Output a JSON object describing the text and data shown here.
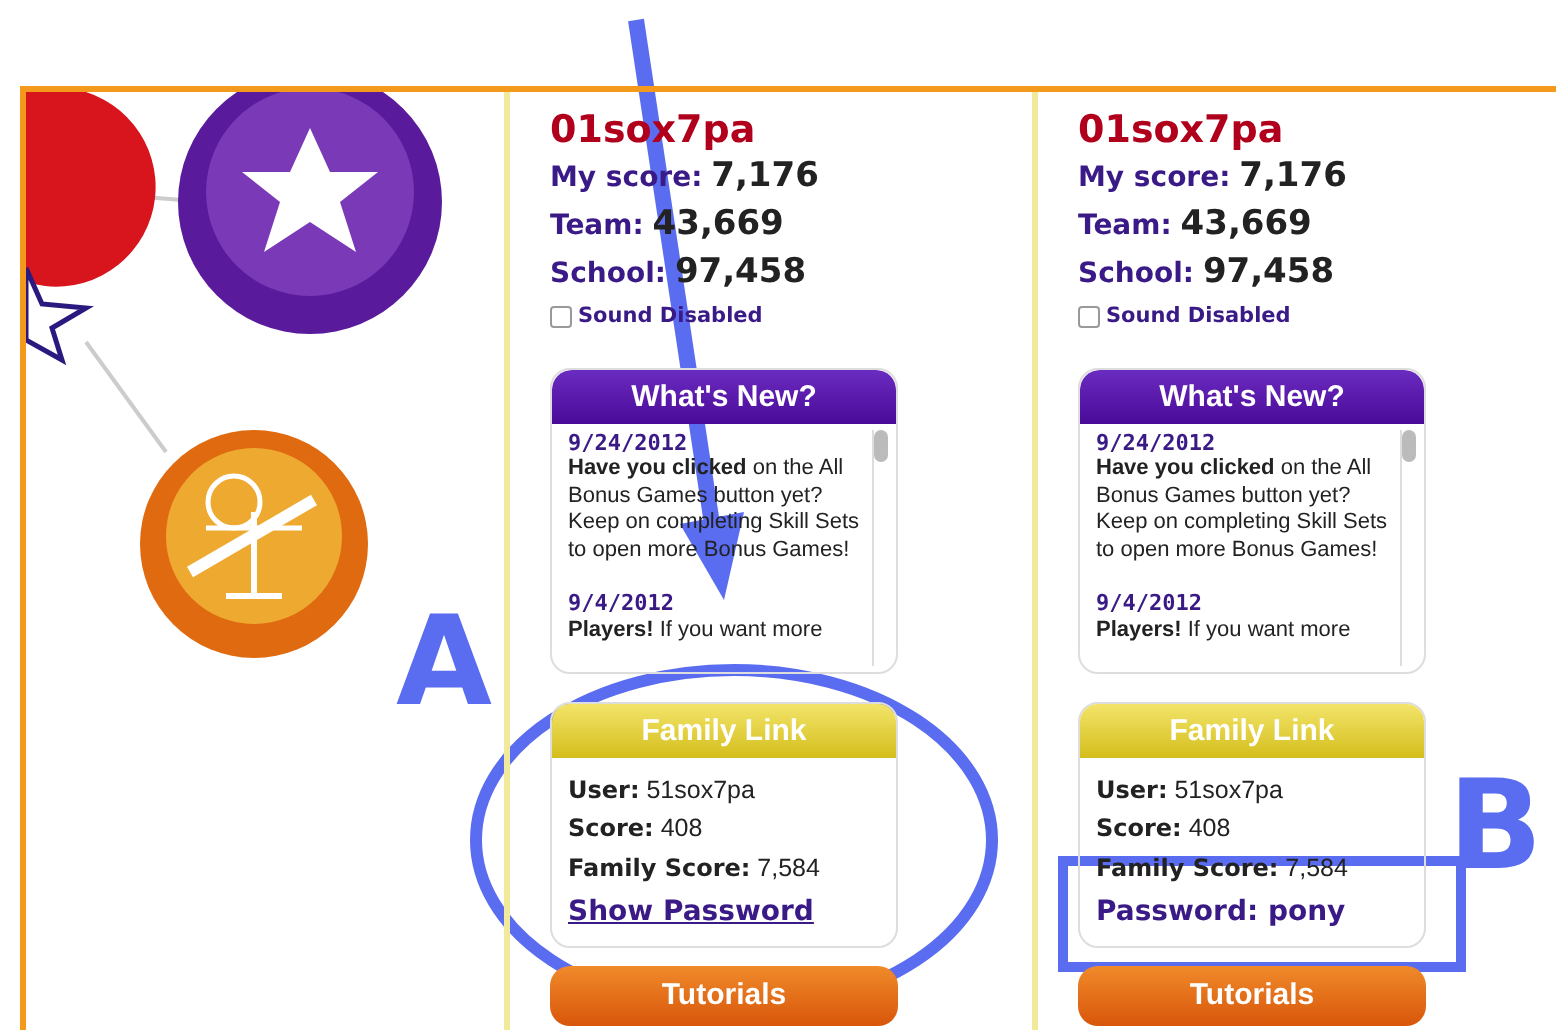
{
  "panels": [
    {
      "username": "01sox7pa",
      "stats": [
        {
          "label": "My score:",
          "value": "7,176"
        },
        {
          "label": "Team:",
          "value": "43,669"
        },
        {
          "label": "School:",
          "value": "97,458"
        }
      ],
      "sound": {
        "label": "Sound Disabled",
        "checked": false
      },
      "whats_new": {
        "title": "What's New?",
        "entries": [
          {
            "date": "9/24/2012",
            "text": "**Have you clicked** on the All Bonus Games button yet? Keep on completing Skill Sets to open more Bonus Games!"
          },
          {
            "date": "9/4/2012",
            "text": "**Players!** If you want more"
          }
        ]
      },
      "family_link": {
        "title": "Family Link",
        "fields": [
          {
            "label": "User:",
            "value": "51sox7pa"
          },
          {
            "label": "Score:",
            "value": "408"
          },
          {
            "label": "Family Score:",
            "value": "7,584"
          }
        ],
        "password": {
          "kind": "link",
          "text": "Show Password"
        }
      },
      "tutorials": "Tutorials"
    },
    {
      "username": "01sox7pa",
      "stats": [
        {
          "label": "My score:",
          "value": "7,176"
        },
        {
          "label": "Team:",
          "value": "43,669"
        },
        {
          "label": "School:",
          "value": "97,458"
        }
      ],
      "sound": {
        "label": "Sound Disabled",
        "checked": false
      },
      "whats_new": {
        "title": "What's New?",
        "entries": [
          {
            "date": "9/24/2012",
            "text": "**Have you clicked** on the All Bonus Games button yet? Keep on completing Skill Sets to open more Bonus Games!"
          },
          {
            "date": "9/4/2012",
            "text": "**Players!** If you want more"
          }
        ]
      },
      "family_link": {
        "title": "Family Link",
        "fields": [
          {
            "label": "User:",
            "value": "51sox7pa"
          },
          {
            "label": "Score:",
            "value": "408"
          },
          {
            "label": "Family Score:",
            "value": "7,584"
          }
        ],
        "password": {
          "kind": "revealed",
          "text": "Password: pony"
        }
      },
      "tutorials": "Tutorials"
    }
  ],
  "annotations": [
    {
      "kind": "arrow"
    },
    {
      "kind": "ellipse"
    },
    {
      "kind": "letter",
      "text": "A"
    },
    {
      "kind": "letter",
      "text": "B"
    },
    {
      "kind": "rectangle"
    }
  ]
}
